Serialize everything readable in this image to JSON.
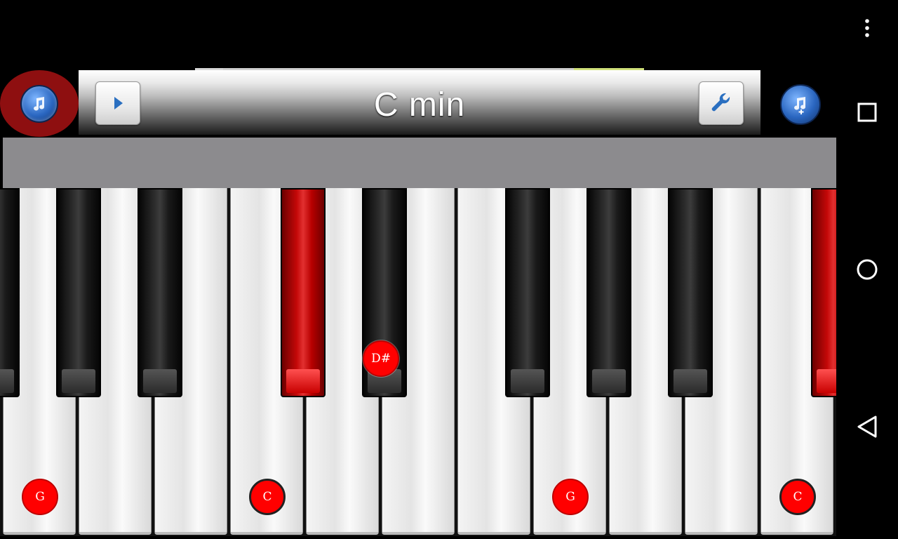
{
  "toolbar": {
    "chord_title": "C min",
    "play_icon": "play-icon",
    "settings_icon": "wrench-icon",
    "music_icon": "music-note-icon",
    "add_song_icon": "music-add-icon"
  },
  "keyboard": {
    "active_color": "#d40000",
    "note_labels": {
      "g_left": "G",
      "c_left": "C",
      "d_sharp": "D#",
      "g_right": "G",
      "c_right": "C"
    }
  },
  "nav": {
    "overflow_icon": "overflow-menu-icon",
    "recents_icon": "recents-square-icon",
    "home_icon": "home-circle-icon",
    "back_icon": "back-triangle-icon"
  }
}
